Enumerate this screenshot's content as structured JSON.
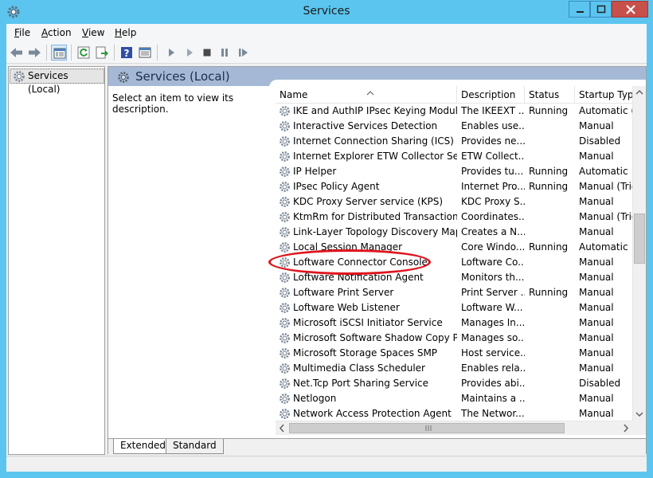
{
  "window": {
    "title": "Services"
  },
  "menu": [
    {
      "label": "File",
      "accel": "F",
      "rest": "ile"
    },
    {
      "label": "Action",
      "accel": "A",
      "rest": "ction"
    },
    {
      "label": "View",
      "accel": "V",
      "rest": "iew"
    },
    {
      "label": "Help",
      "accel": "H",
      "rest": "elp"
    }
  ],
  "tree": {
    "root_label": "Services (Local)"
  },
  "pane": {
    "title": "Services (Local)",
    "description": "Select an item to view its description."
  },
  "columns": {
    "name": "Name",
    "description": "Description",
    "status": "Status",
    "startup": "Startup Type"
  },
  "services": [
    {
      "name": "IKE and AuthIP IPsec Keying Modules",
      "description": "The IKEEXT ...",
      "status": "Running",
      "startup": "Automatic (T"
    },
    {
      "name": "Interactive Services Detection",
      "description": "Enables use...",
      "status": "",
      "startup": "Manual"
    },
    {
      "name": "Internet Connection Sharing (ICS)",
      "description": "Provides ne...",
      "status": "",
      "startup": "Disabled"
    },
    {
      "name": "Internet Explorer ETW Collector Servi...",
      "description": "ETW Collect...",
      "status": "",
      "startup": "Manual"
    },
    {
      "name": "IP Helper",
      "description": "Provides tu...",
      "status": "Running",
      "startup": "Automatic"
    },
    {
      "name": "IPsec Policy Agent",
      "description": "Internet Pro...",
      "status": "Running",
      "startup": "Manual (Trig"
    },
    {
      "name": "KDC Proxy Server service (KPS)",
      "description": "KDC Proxy S...",
      "status": "",
      "startup": "Manual"
    },
    {
      "name": "KtmRm for Distributed Transaction ...",
      "description": "Coordinates...",
      "status": "",
      "startup": "Manual (Trig"
    },
    {
      "name": "Link-Layer Topology Discovery Map...",
      "description": "Creates a N...",
      "status": "",
      "startup": "Manual"
    },
    {
      "name": "Local Session Manager",
      "description": "Core Windo...",
      "status": "Running",
      "startup": "Automatic"
    },
    {
      "name": "Loftware Connector Console",
      "description": "Loftware Co...",
      "status": "",
      "startup": "Manual"
    },
    {
      "name": "Loftware Notification Agent",
      "description": "Monitors th...",
      "status": "",
      "startup": "Manual"
    },
    {
      "name": "Loftware Print Server",
      "description": "Print Server ...",
      "status": "Running",
      "startup": "Manual"
    },
    {
      "name": "Loftware Web Listener",
      "description": "Loftware W...",
      "status": "",
      "startup": "Manual"
    },
    {
      "name": "Microsoft iSCSI Initiator Service",
      "description": "Manages In...",
      "status": "",
      "startup": "Manual"
    },
    {
      "name": "Microsoft Software Shadow Copy Pr...",
      "description": "Manages so...",
      "status": "",
      "startup": "Manual"
    },
    {
      "name": "Microsoft Storage Spaces SMP",
      "description": "Host service...",
      "status": "",
      "startup": "Manual"
    },
    {
      "name": "Multimedia Class Scheduler",
      "description": "Enables rela...",
      "status": "",
      "startup": "Manual"
    },
    {
      "name": "Net.Tcp Port Sharing Service",
      "description": "Provides abi...",
      "status": "",
      "startup": "Disabled"
    },
    {
      "name": "Netlogon",
      "description": "Maintains a ...",
      "status": "",
      "startup": "Manual"
    },
    {
      "name": "Network Access Protection Agent",
      "description": "The Networ...",
      "status": "",
      "startup": "Manual"
    }
  ],
  "tabs": {
    "extended": "Extended",
    "standard": "Standard"
  },
  "icons": {
    "app": "services-gear-icon",
    "toolbar": [
      "back-arrow-icon",
      "forward-arrow-icon",
      "show-hide-console-tree-icon",
      "refresh-icon",
      "export-list-icon",
      "help-icon",
      "properties-icon",
      "start-service-icon",
      "start-service-alt-icon",
      "stop-service-icon",
      "pause-service-icon",
      "restart-service-icon"
    ]
  },
  "colors": {
    "frame": "#5bc5f0",
    "close_button": "#c7504a",
    "pane_header": "#a5b9d6",
    "highlight_ellipse": "#e0141c"
  }
}
